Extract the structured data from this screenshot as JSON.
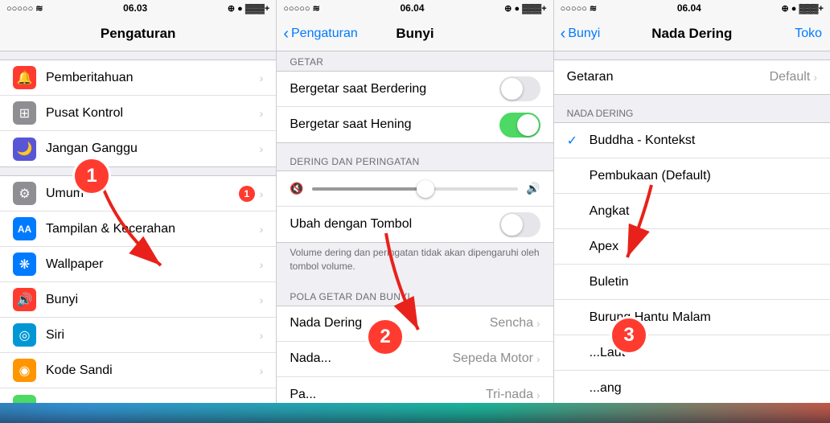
{
  "panels": [
    {
      "id": "panel1",
      "statusBar": {
        "left": "○○○○○",
        "wifi": "WiFi",
        "time": "06.03",
        "right": "⊕ ● ▓▓▓ +"
      },
      "navTitle": "Pengaturan",
      "navBack": null,
      "sections": [
        {
          "items": [
            {
              "icon": "🔔",
              "iconBg": "#ff3b30",
              "label": "Pemberitahuan",
              "hasChevron": true
            },
            {
              "icon": "⊞",
              "iconBg": "#8e8e93",
              "label": "Pusat Kontrol",
              "hasChevron": true
            },
            {
              "icon": "🌙",
              "iconBg": "#5856d6",
              "label": "Jangan Ganggu",
              "hasChevron": true
            }
          ]
        },
        {
          "items": [
            {
              "icon": "⚙",
              "iconBg": "#8e8e93",
              "label": "Umum",
              "badge": "1",
              "hasChevron": true
            },
            {
              "icon": "AA",
              "iconBg": "#007aff",
              "label": "Tampilan & Kecerahan",
              "hasChevron": true
            },
            {
              "icon": "❋",
              "iconBg": "#007aff",
              "label": "Wallpaper",
              "hasChevron": true
            },
            {
              "icon": "🔊",
              "iconBg": "#ff3b30",
              "label": "Bunyi",
              "hasChevron": true
            },
            {
              "icon": "◎",
              "iconBg": "#0097d4",
              "label": "Siri",
              "hasChevron": true
            },
            {
              "icon": "◉",
              "iconBg": "#ff9500",
              "label": "Kode Sandi",
              "hasChevron": true
            },
            {
              "icon": "▬",
              "iconBg": "#4cd964",
              "label": "",
              "hasChevron": true
            }
          ]
        }
      ]
    },
    {
      "id": "panel2",
      "statusBar": {
        "left": "○○○○○",
        "wifi": "WiFi",
        "time": "06.04",
        "right": "⊕ ● ▓▓▓ +"
      },
      "navTitle": "Bunyi",
      "navBack": "Pengaturan",
      "sections": [
        {
          "header": "GETAR",
          "items": [
            {
              "label": "Bergetar saat Berdering",
              "type": "toggle",
              "toggleOn": false
            },
            {
              "label": "Bergetar saat Hening",
              "type": "toggle",
              "toggleOn": true
            }
          ]
        },
        {
          "header": "DERING DAN PERINGATAN",
          "items": [
            {
              "type": "volume"
            },
            {
              "label": "Ubah dengan Tombol",
              "type": "toggle",
              "toggleOn": false
            }
          ]
        },
        {
          "description": "Volume dering dan peringatan tidak akan dipengaruhi oleh tombol volume."
        },
        {
          "header": "POLA GETAR DAN BUNYI",
          "items": [
            {
              "label": "Nada Dering",
              "value": "Sencha",
              "hasChevron": true
            },
            {
              "label": "Nada...",
              "value": "Sepeda Motor",
              "hasChevron": true
            },
            {
              "label": "Pa...",
              "value": "Tri-nada",
              "hasChevron": true
            }
          ]
        }
      ]
    },
    {
      "id": "panel3",
      "statusBar": {
        "left": "○○○○○",
        "wifi": "WiFi",
        "time": "06.04",
        "right": "⊕ ● ▓▓▓ +"
      },
      "navTitle": "Nada Dering",
      "navBack": "Bunyi",
      "navRight": "Toko",
      "sections": [
        {
          "items": [
            {
              "label": "Getaran",
              "value": "Default",
              "hasChevron": true
            }
          ]
        },
        {
          "header": "NADA DERING",
          "items": [
            {
              "label": "Buddha - Kontekst",
              "checked": true
            },
            {
              "label": "Pembukaan (Default)",
              "checked": false
            },
            {
              "label": "Angkat",
              "checked": false
            },
            {
              "label": "Apex",
              "checked": false
            },
            {
              "label": "Buletin",
              "checked": false
            },
            {
              "label": "Burung Hantu Malam",
              "checked": false
            },
            {
              "label": "...Laut",
              "checked": false
            },
            {
              "label": "...ang",
              "checked": false
            }
          ]
        }
      ]
    }
  ],
  "arrows": [
    {
      "id": "arrow1",
      "num": "1"
    },
    {
      "id": "arrow2",
      "num": "2"
    },
    {
      "id": "arrow3",
      "num": "3"
    }
  ]
}
